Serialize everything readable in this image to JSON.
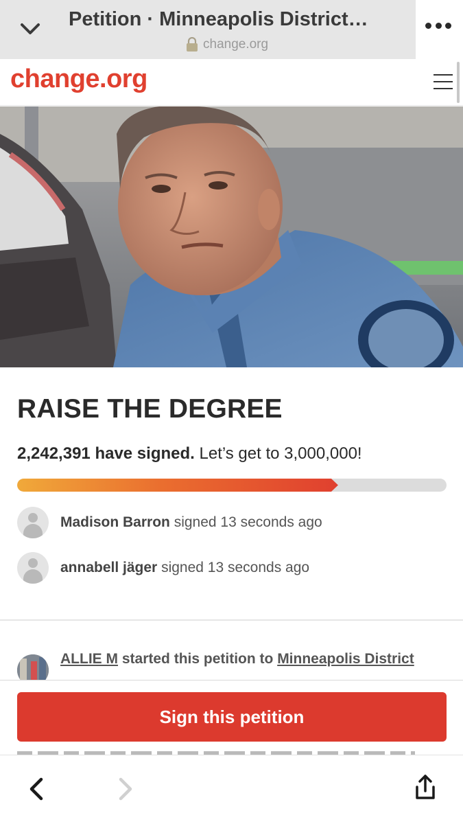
{
  "browser": {
    "title": "Petition · Minneapolis District…",
    "url": "change.org",
    "icons": [
      "chevron-down-icon",
      "lock-icon",
      "more-dots-icon"
    ]
  },
  "site": {
    "logo": "change.org",
    "menu_icon": "hamburger-icon"
  },
  "petition": {
    "title": "RAISE THE DEGREE",
    "signed_count": "2,242,391 have signed.",
    "goal_text": "Let’s get to 3,000,000!",
    "progress_fraction": 0.7475
  },
  "recent_signers": [
    {
      "name": "Madison Barron",
      "action": "signed 13 seconds ago"
    },
    {
      "name": "annabell jäger",
      "action": "signed 13 seconds ago"
    }
  ],
  "starter": {
    "name": "ALLIE M",
    "middle_text": "started this petition to",
    "target": "Minneapolis District"
  },
  "cta": {
    "sign_label": "Sign this petition"
  },
  "toolbar": {
    "icons": [
      "back-arrow-icon",
      "forward-arrow-icon",
      "share-icon"
    ]
  },
  "colors": {
    "brand": "#e0402f",
    "button": "#dc3a2e",
    "progress_start": "#f0a93a",
    "progress_end": "#e0402f"
  }
}
